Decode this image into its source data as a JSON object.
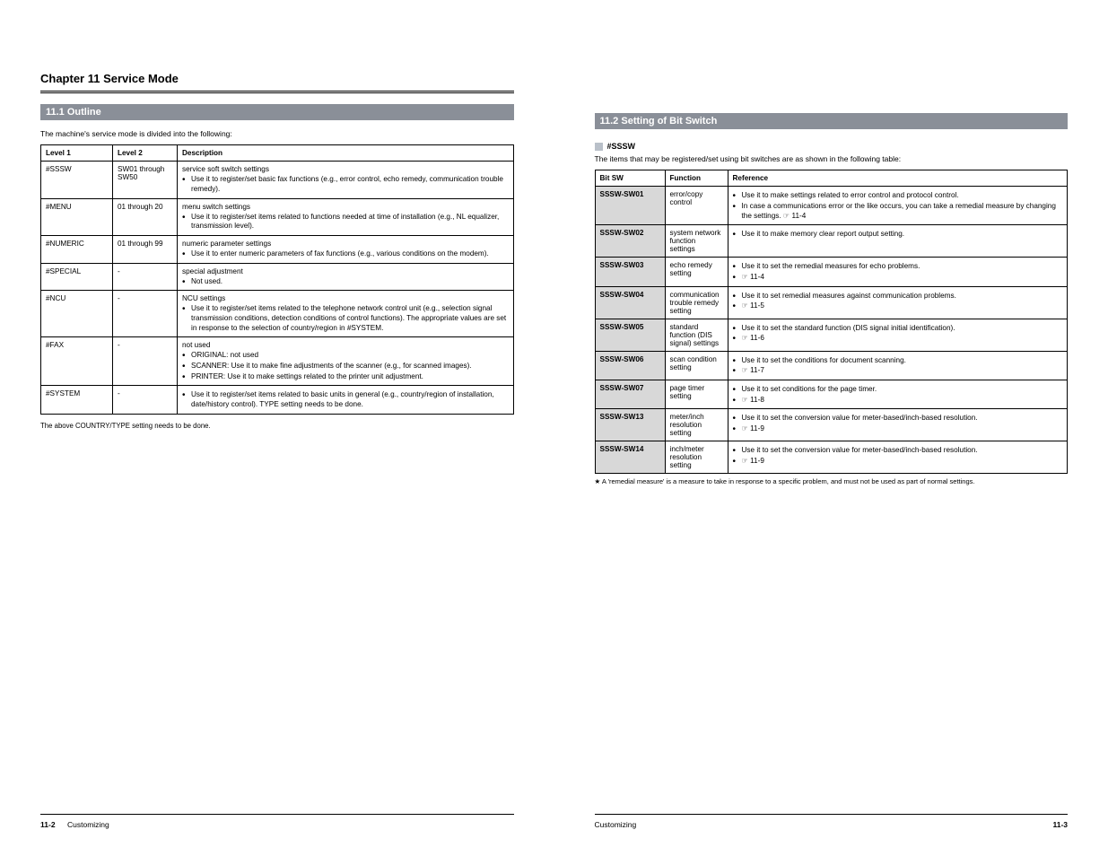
{
  "left": {
    "chapter": "Chapter 11 Service Mode",
    "section": "11.1 Outline",
    "intro": "The machine's service mode is divided into the following:",
    "table": {
      "head": [
        "Level 1",
        "Level 2",
        "Description"
      ],
      "rows": [
        {
          "l1": "#SSSW",
          "l2": "SW01 through SW50",
          "lead": "service soft switch settings",
          "bullets": [
            "Use it to register/set basic fax functions (e.g., error control, echo remedy, communication trouble remedy)."
          ]
        },
        {
          "l1": "#MENU",
          "l2": "01 through 20",
          "lead": "menu switch settings",
          "bullets": [
            "Use it to register/set items related to functions needed at time of installation (e.g., NL equalizer, transmission level)."
          ]
        },
        {
          "l1": "#NUMERIC",
          "l2": "01 through 99",
          "lead": "numeric parameter settings",
          "bullets": [
            "Use it to enter numeric parameters of fax functions (e.g., various conditions on the modem)."
          ]
        },
        {
          "l1": "#SPECIAL",
          "l2": "-",
          "lead": "special adjustment",
          "bullets": [
            "Not used."
          ]
        },
        {
          "l1": "#NCU",
          "l2": "-",
          "lead": "NCU settings",
          "bullets": [
            "Use it to register/set items related to the telephone network control unit (e.g., selection signal transmission conditions, detection conditions of control functions). The appropriate values are set in response to the selection of country/region in #SYSTEM."
          ]
        },
        {
          "l1": "#FAX",
          "l2": "-",
          "lead": "not used",
          "bullets": [
            "ORIGINAL: not used",
            "SCANNER: Use it to make fine adjustments of the scanner (e.g., for scanned images).",
            "PRINTER: Use it to make settings related to the printer unit adjustment."
          ]
        },
        {
          "l1": "#SYSTEM",
          "l2": "-",
          "lead": "",
          "bullets": [
            "Use it to register/set items related to basic units in general (e.g., country/region of installation, date/history control). TYPE setting needs to be done."
          ]
        }
      ]
    },
    "footnote": "The above COUNTRY/TYPE setting needs to be done.",
    "foot_page": "11-2",
    "foot_label": "Customizing"
  },
  "right": {
    "section": "11.2 Setting of Bit Switch",
    "sub": "#SSSW",
    "intro": "The items that may be registered/set using bit switches are as shown in the following table:",
    "table": {
      "head": [
        "Bit SW",
        "Function",
        "Reference"
      ],
      "rows": [
        {
          "sw": "SSSW-SW01",
          "fn": "error/copy control",
          "bullets": [
            "Use it to make settings related to error control and protocol control.",
            "In case a communications error or the like occurs, you can take a remedial measure by changing the settings.   ☞ 11-4"
          ]
        },
        {
          "sw": "SSSW-SW02",
          "fn": "system network function settings",
          "bullets": [
            "Use it to make memory clear report output setting."
          ]
        },
        {
          "sw": "SSSW-SW03",
          "fn": "echo remedy setting",
          "bullets": [
            "Use it to set the remedial measures for echo problems.",
            "☞ 11-4"
          ]
        },
        {
          "sw": "SSSW-SW04",
          "fn": "communication trouble remedy setting",
          "bullets": [
            "Use it to set remedial measures against communication problems.",
            "☞ 11-5"
          ]
        },
        {
          "sw": "SSSW-SW05",
          "fn": "standard function (DIS signal) settings",
          "bullets": [
            "Use it to set the standard function (DIS signal initial identification).",
            "☞ 11-6"
          ]
        },
        {
          "sw": "SSSW-SW06",
          "fn": "scan condition setting",
          "bullets": [
            "Use it to set the conditions for document scanning.",
            "☞ 11-7"
          ]
        },
        {
          "sw": "SSSW-SW07",
          "fn": "page timer setting",
          "bullets": [
            "Use it to set conditions for the page timer.",
            "☞ 11-8"
          ]
        },
        {
          "sw": "SSSW-SW13",
          "fn": "meter/inch resolution setting",
          "bullets": [
            "Use it to set the conversion value for meter-based/inch-based resolution.",
            "☞ 11-9"
          ]
        },
        {
          "sw": "SSSW-SW14",
          "fn": "inch/meter resolution setting",
          "bullets": [
            "Use it to set the conversion value for meter-based/inch-based resolution.",
            "☞ 11-9"
          ]
        }
      ]
    },
    "note": "★ A 'remedial measure' is a measure to take in response to a specific problem, and must not be used as part of normal settings.",
    "foot_label": "Customizing",
    "foot_page": "11-3"
  }
}
